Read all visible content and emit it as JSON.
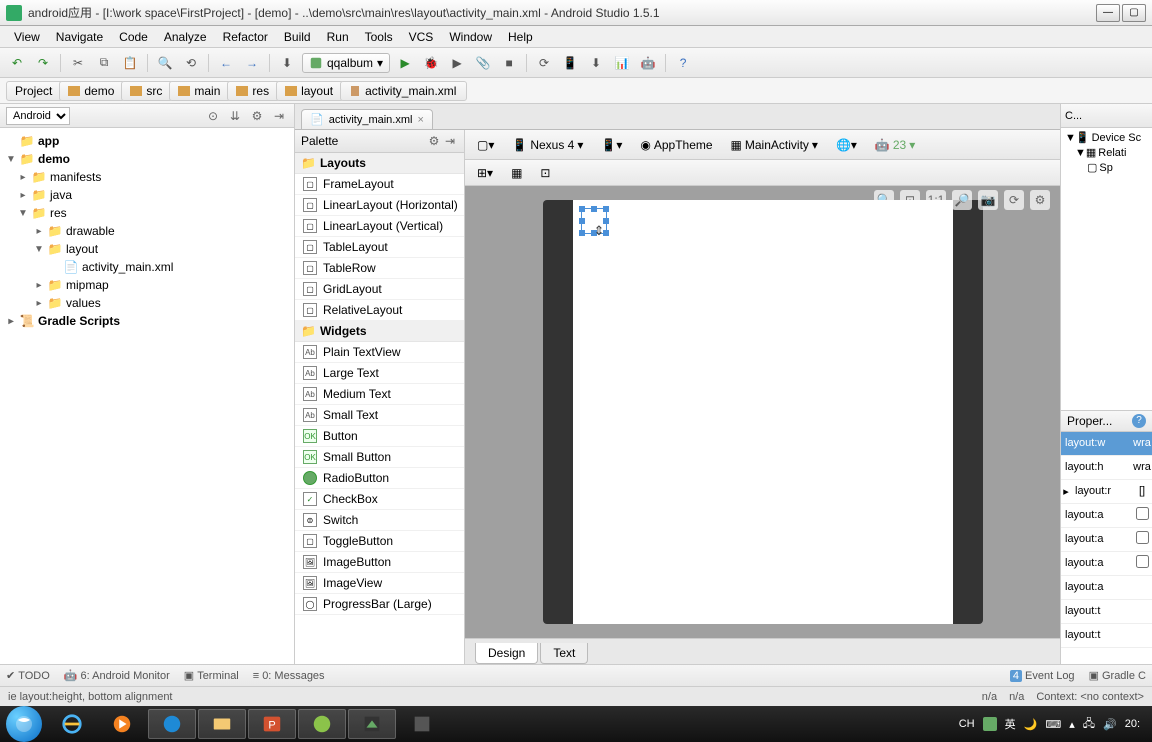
{
  "title": "android应用 - [I:\\work space\\FirstProject] - [demo] - ..\\demo\\src\\main\\res\\layout\\activity_main.xml - Android Studio 1.5.1",
  "menu": [
    "View",
    "Navigate",
    "Code",
    "Analyze",
    "Refactor",
    "Build",
    "Run",
    "Tools",
    "VCS",
    "Window",
    "Help"
  ],
  "run_config": "qqalbum",
  "breadcrumbs": [
    "Project",
    "demo",
    "src",
    "main",
    "res",
    "layout",
    "activity_main.xml"
  ],
  "project_dropdown": "Android",
  "project_tree": {
    "app": "app",
    "demo": "demo",
    "manifests": "manifests",
    "java": "java",
    "res": "res",
    "drawable": "drawable",
    "layout": "layout",
    "activity_main": "activity_main.xml",
    "mipmap": "mipmap",
    "values": "values",
    "gradle_scripts": "Gradle Scripts"
  },
  "tab_file": "activity_main.xml",
  "palette_title": "Palette",
  "palette_groups": {
    "layouts": {
      "header": "Layouts",
      "items": [
        "FrameLayout",
        "LinearLayout (Horizontal)",
        "LinearLayout (Vertical)",
        "TableLayout",
        "TableRow",
        "GridLayout",
        "RelativeLayout"
      ]
    },
    "widgets": {
      "header": "Widgets",
      "items": [
        "Plain TextView",
        "Large Text",
        "Medium Text",
        "Small Text",
        "Button",
        "Small Button",
        "RadioButton",
        "CheckBox",
        "Switch",
        "ToggleButton",
        "ImageButton",
        "ImageView",
        "ProgressBar (Large)"
      ]
    }
  },
  "design_toolbar": {
    "device": "Nexus 4",
    "theme": "AppTheme",
    "activity": "MainActivity",
    "api": "23"
  },
  "bottom_tabs": {
    "design": "Design",
    "text": "Text"
  },
  "component_tree_header": "C...",
  "component_tree": {
    "root": "Device Sc",
    "child1": "Relati",
    "child2": "Sp"
  },
  "properties_header": "Proper...",
  "properties": [
    {
      "key": "layout:w",
      "val": "wra",
      "sel": true
    },
    {
      "key": "layout:h",
      "val": "wra"
    },
    {
      "key": "layout:r",
      "val": "[]",
      "expand": true
    },
    {
      "key": "layout:a",
      "val": "cb"
    },
    {
      "key": "layout:a",
      "val": "cb"
    },
    {
      "key": "layout:a",
      "val": "cb"
    },
    {
      "key": "layout:a",
      "val": ""
    },
    {
      "key": "layout:t",
      "val": ""
    },
    {
      "key": "layout:t",
      "val": ""
    }
  ],
  "tool_windows": {
    "todo": "TODO",
    "monitor": "6: Android Monitor",
    "terminal": "Terminal",
    "messages": "0: Messages",
    "event_log": "Event Log",
    "gradle_console": "Gradle C"
  },
  "event_log_badge": "4",
  "status_left": "ie layout:height, bottom alignment",
  "status_right": {
    "na1": "n/a",
    "na2": "n/a",
    "context": "Context: <no context>"
  },
  "taskbar": {
    "ime_lang": "CH",
    "ime_mode": "英",
    "time": "20:"
  }
}
